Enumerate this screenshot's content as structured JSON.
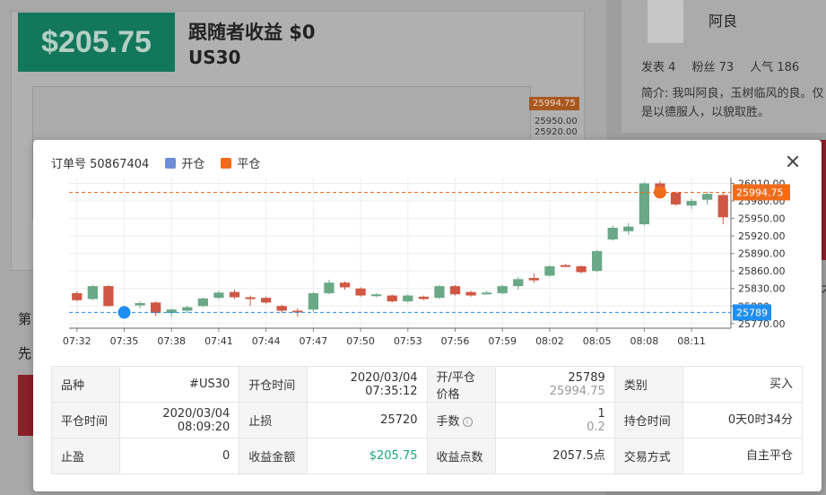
{
  "background": {
    "profit": "$205.75",
    "follower_profit": "跟随者收益 $0",
    "symbol": "US30",
    "chart_price_tag": "25994.75",
    "chart_price_2": "25950.00",
    "chart_price_3": "25920.00",
    "author": {
      "name": "阿良",
      "stats": [
        {
          "label": "发表",
          "value": "4"
        },
        {
          "label": "粉丝",
          "value": "73"
        },
        {
          "label": "人气",
          "value": "186"
        }
      ],
      "bio": "简介: 我叫阿良，玉树临风的良。仅是以德服人，以貌取胜。"
    },
    "side_text_1": "第",
    "side_text_2": "先",
    "edge_text": "才"
  },
  "modal": {
    "order_label": "订单号 50867404",
    "legend": [
      {
        "label": "开仓",
        "color": "#6b8fd6"
      },
      {
        "label": "平仓",
        "color": "#ef6c1a"
      }
    ],
    "table": [
      [
        {
          "label": "品种",
          "value": "#US30"
        },
        {
          "label": "开仓时间",
          "value": "2020/03/04",
          "value2": "07:35:12"
        },
        {
          "label": "开/平仓价格",
          "value": "25789",
          "value2": "25994.75"
        },
        {
          "label": "类别",
          "value": "买入"
        }
      ],
      [
        {
          "label": "平仓时间",
          "value": "2020/03/04",
          "value2": "08:09:20"
        },
        {
          "label": "止损",
          "value": "25720"
        },
        {
          "label": "手数",
          "value": "1",
          "value2": "0.2"
        },
        {
          "label": "持仓时间",
          "value": "0天0时34分"
        }
      ],
      [
        {
          "label": "止盈",
          "value": "0"
        },
        {
          "label": "收益金额",
          "value": "$205.75"
        },
        {
          "label": "收益点数",
          "value": "2057.5点"
        },
        {
          "label": "交易方式",
          "value": "自主平仓"
        }
      ]
    ],
    "info_icon": "info-circle-icon",
    "close_icon": "close-icon"
  },
  "chart_data": {
    "type": "candlestick",
    "x_ticks": [
      "07:32",
      "07:35",
      "07:38",
      "07:41",
      "07:44",
      "07:47",
      "07:50",
      "07:53",
      "07:56",
      "07:59",
      "08:02",
      "08:05",
      "08:08",
      "08:11"
    ],
    "y_ticks": [
      25770,
      25800,
      25830,
      25860,
      25890,
      25920,
      25950,
      25980,
      26010
    ],
    "y_labels_visible": [
      "25770.00",
      "25800",
      "25830.00",
      "25860.00",
      "25890.00",
      "25920.00",
      "25950.00",
      "25980.00",
      "26010.00"
    ],
    "ylim": [
      25762,
      26020
    ],
    "grid": true,
    "up_color": "#6aa887",
    "down_color": "#cf5744",
    "candles": [
      {
        "t": "07:32",
        "o": 25822,
        "h": 25825,
        "l": 25808,
        "c": 25810
      },
      {
        "t": "07:33",
        "o": 25812,
        "h": 25836,
        "l": 25810,
        "c": 25834
      },
      {
        "t": "07:34",
        "o": 25834,
        "h": 25836,
        "l": 25799,
        "c": 25800
      },
      {
        "t": "07:35",
        "o": 25794,
        "h": 25800,
        "l": 25786,
        "c": 25789
      },
      {
        "t": "07:36",
        "o": 25801,
        "h": 25808,
        "l": 25796,
        "c": 25805
      },
      {
        "t": "07:37",
        "o": 25806,
        "h": 25808,
        "l": 25783,
        "c": 25788
      },
      {
        "t": "07:38",
        "o": 25788,
        "h": 25796,
        "l": 25782,
        "c": 25794
      },
      {
        "t": "07:39",
        "o": 25792,
        "h": 25800,
        "l": 25788,
        "c": 25798
      },
      {
        "t": "07:40",
        "o": 25800,
        "h": 25815,
        "l": 25798,
        "c": 25813
      },
      {
        "t": "07:41",
        "o": 25814,
        "h": 25826,
        "l": 25812,
        "c": 25823
      },
      {
        "t": "07:42",
        "o": 25824,
        "h": 25828,
        "l": 25812,
        "c": 25815
      },
      {
        "t": "07:43",
        "o": 25815,
        "h": 25818,
        "l": 25800,
        "c": 25814
      },
      {
        "t": "07:44",
        "o": 25814,
        "h": 25816,
        "l": 25804,
        "c": 25806
      },
      {
        "t": "07:45",
        "o": 25800,
        "h": 25802,
        "l": 25788,
        "c": 25792
      },
      {
        "t": "07:46",
        "o": 25792,
        "h": 25796,
        "l": 25782,
        "c": 25790
      },
      {
        "t": "07:47",
        "o": 25794,
        "h": 25824,
        "l": 25790,
        "c": 25822
      },
      {
        "t": "07:48",
        "o": 25822,
        "h": 25845,
        "l": 25820,
        "c": 25840
      },
      {
        "t": "07:49",
        "o": 25840,
        "h": 25842,
        "l": 25828,
        "c": 25832
      },
      {
        "t": "07:50",
        "o": 25830,
        "h": 25832,
        "l": 25816,
        "c": 25818
      },
      {
        "t": "07:51",
        "o": 25818,
        "h": 25822,
        "l": 25815,
        "c": 25820
      },
      {
        "t": "07:52",
        "o": 25818,
        "h": 25820,
        "l": 25806,
        "c": 25808
      },
      {
        "t": "07:53",
        "o": 25808,
        "h": 25820,
        "l": 25806,
        "c": 25818
      },
      {
        "t": "07:54",
        "o": 25816,
        "h": 25818,
        "l": 25810,
        "c": 25812
      },
      {
        "t": "07:55",
        "o": 25814,
        "h": 25836,
        "l": 25812,
        "c": 25834
      },
      {
        "t": "07:56",
        "o": 25834,
        "h": 25836,
        "l": 25818,
        "c": 25820
      },
      {
        "t": "07:57",
        "o": 25824,
        "h": 25826,
        "l": 25816,
        "c": 25818
      },
      {
        "t": "07:58",
        "o": 25822,
        "h": 25826,
        "l": 25820,
        "c": 25823
      },
      {
        "t": "07:59",
        "o": 25822,
        "h": 25836,
        "l": 25820,
        "c": 25834
      },
      {
        "t": "08:00",
        "o": 25834,
        "h": 25850,
        "l": 25828,
        "c": 25846
      },
      {
        "t": "08:01",
        "o": 25848,
        "h": 25856,
        "l": 25840,
        "c": 25844
      },
      {
        "t": "08:02",
        "o": 25852,
        "h": 25870,
        "l": 25850,
        "c": 25868
      },
      {
        "t": "08:03",
        "o": 25870,
        "h": 25872,
        "l": 25868,
        "c": 25869
      },
      {
        "t": "08:04",
        "o": 25868,
        "h": 25870,
        "l": 25856,
        "c": 25858
      },
      {
        "t": "08:05",
        "o": 25860,
        "h": 25896,
        "l": 25858,
        "c": 25894
      },
      {
        "t": "08:06",
        "o": 25914,
        "h": 25938,
        "l": 25912,
        "c": 25934
      },
      {
        "t": "08:07",
        "o": 25928,
        "h": 25942,
        "l": 25922,
        "c": 25936
      },
      {
        "t": "08:08",
        "o": 25940,
        "h": 26012,
        "l": 25938,
        "c": 26010
      },
      {
        "t": "08:09",
        "o": 26010,
        "h": 26014,
        "l": 25990,
        "c": 25994
      },
      {
        "t": "08:10",
        "o": 25994,
        "h": 25996,
        "l": 25972,
        "c": 25974
      },
      {
        "t": "08:11",
        "o": 25972,
        "h": 25984,
        "l": 25966,
        "c": 25980
      },
      {
        "t": "08:12",
        "o": 25982,
        "h": 25996,
        "l": 25974,
        "c": 25992
      },
      {
        "t": "08:13",
        "o": 25990,
        "h": 25994,
        "l": 25940,
        "c": 25952
      }
    ],
    "markers": [
      {
        "type": "open",
        "t": "07:35",
        "price": 25789,
        "label": "25789",
        "color": "#1f8ef1"
      },
      {
        "type": "close",
        "t": "08:09",
        "price": 25994.75,
        "label": "25994.75",
        "color": "#ef6c1a"
      }
    ]
  }
}
